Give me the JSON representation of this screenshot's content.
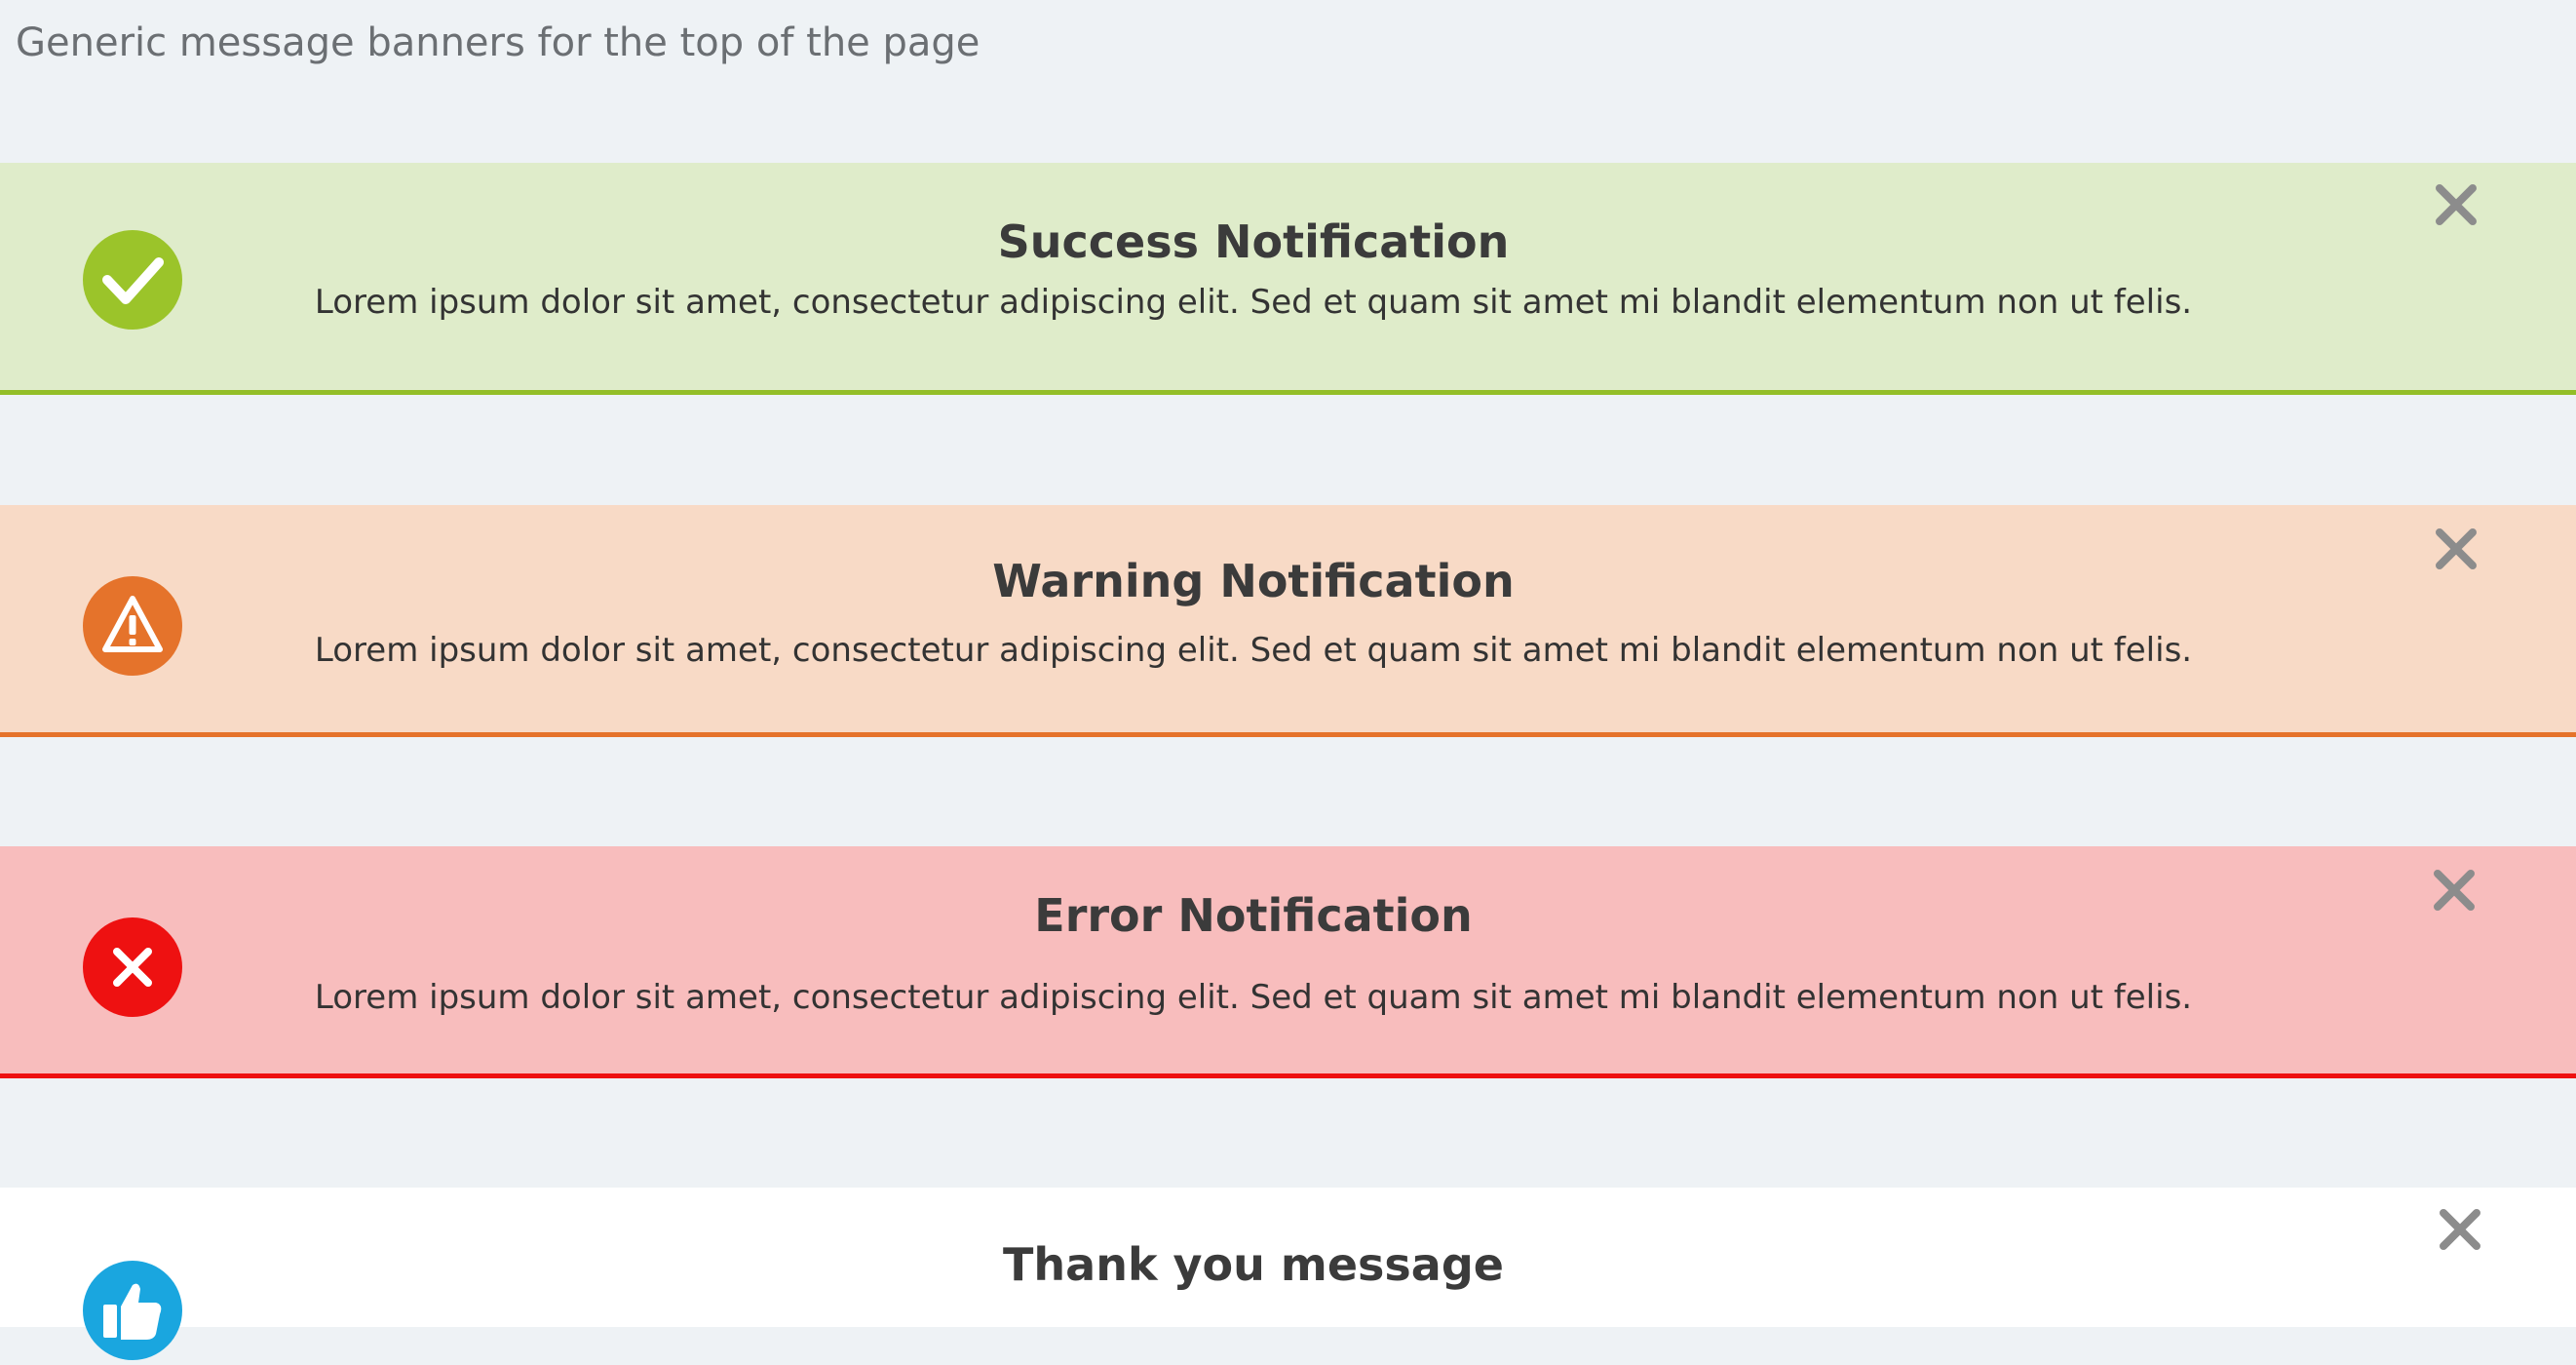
{
  "page": {
    "heading": "Generic message banners for the top of the page"
  },
  "banners": [
    {
      "type": "success",
      "title": "Success Notification",
      "body": "Lorem ipsum dolor sit amet, consectetur adipiscing elit. Sed et quam sit amet mi blandit elementum non ut felis.",
      "icon": "check-circle-icon",
      "accent": "#93be28",
      "background": "#dfecca"
    },
    {
      "type": "warning",
      "title": "Warning Notification",
      "body": "Lorem ipsum dolor sit amet, consectetur adipiscing elit. Sed et quam sit amet mi blandit elementum non ut felis.",
      "icon": "warning-triangle-icon",
      "accent": "#e5732b",
      "background": "#f8dac6"
    },
    {
      "type": "error",
      "title": "Error Notification",
      "body": "Lorem ipsum dolor sit amet, consectetur adipiscing elit. Sed et quam sit amet mi blandit elementum non ut felis.",
      "icon": "x-circle-icon",
      "accent": "#ee1111",
      "background": "#f8bdbd"
    },
    {
      "type": "thanks",
      "title": "Thank you message",
      "icon": "thumbs-up-icon",
      "accent": "#1aa6df",
      "background": "#ffffff"
    }
  ],
  "close_icon": "close-icon",
  "close_color": "#8c8c8c"
}
